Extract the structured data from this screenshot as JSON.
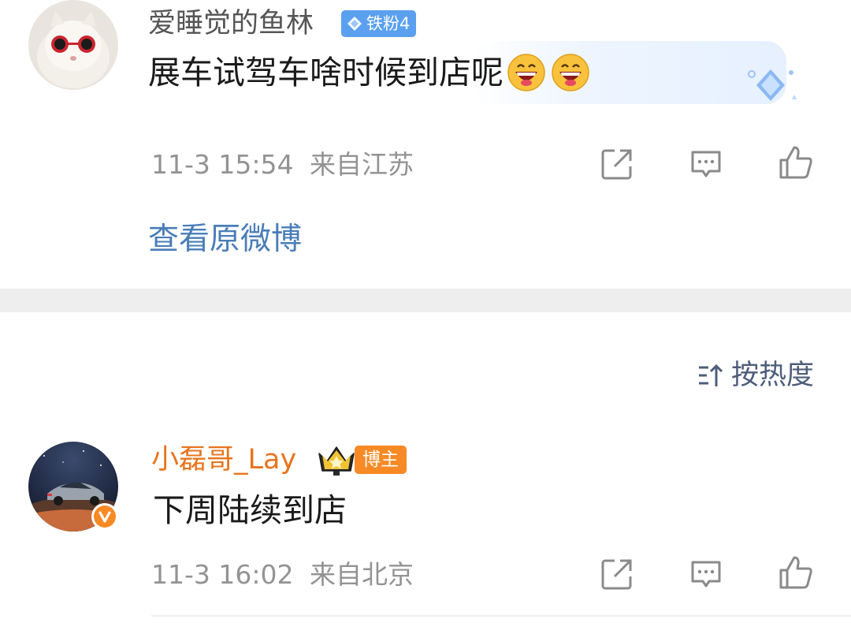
{
  "comment": {
    "username": "爱睡觉的鱼林",
    "username_color": "#555555",
    "fan_badge": "铁粉4",
    "text": "展车试驾车啥时候到店呢",
    "emojis": [
      "grinning-face-icon",
      "grinning-face-icon"
    ],
    "time": "11-3 15:54",
    "location": "来自江苏",
    "actions": [
      "share-icon",
      "comment-icon",
      "like-icon"
    ]
  },
  "view_original": "查看原微博",
  "sort": {
    "icon": "sort-icon",
    "label": "按热度"
  },
  "reply": {
    "username": "小磊哥_Lay",
    "username_color": "#e8741d",
    "host_badge": "博主",
    "text": "下周陆续到店",
    "time": "11-3 16:02",
    "location": "来自北京",
    "actions": [
      "share-icon",
      "comment-icon",
      "like-icon"
    ]
  },
  "colors": {
    "link": "#4a7db8",
    "meta_text": "#939393",
    "fan_badge": "#5aa0ef",
    "host_badge": "#f88a25",
    "verified": "#f88a25"
  }
}
